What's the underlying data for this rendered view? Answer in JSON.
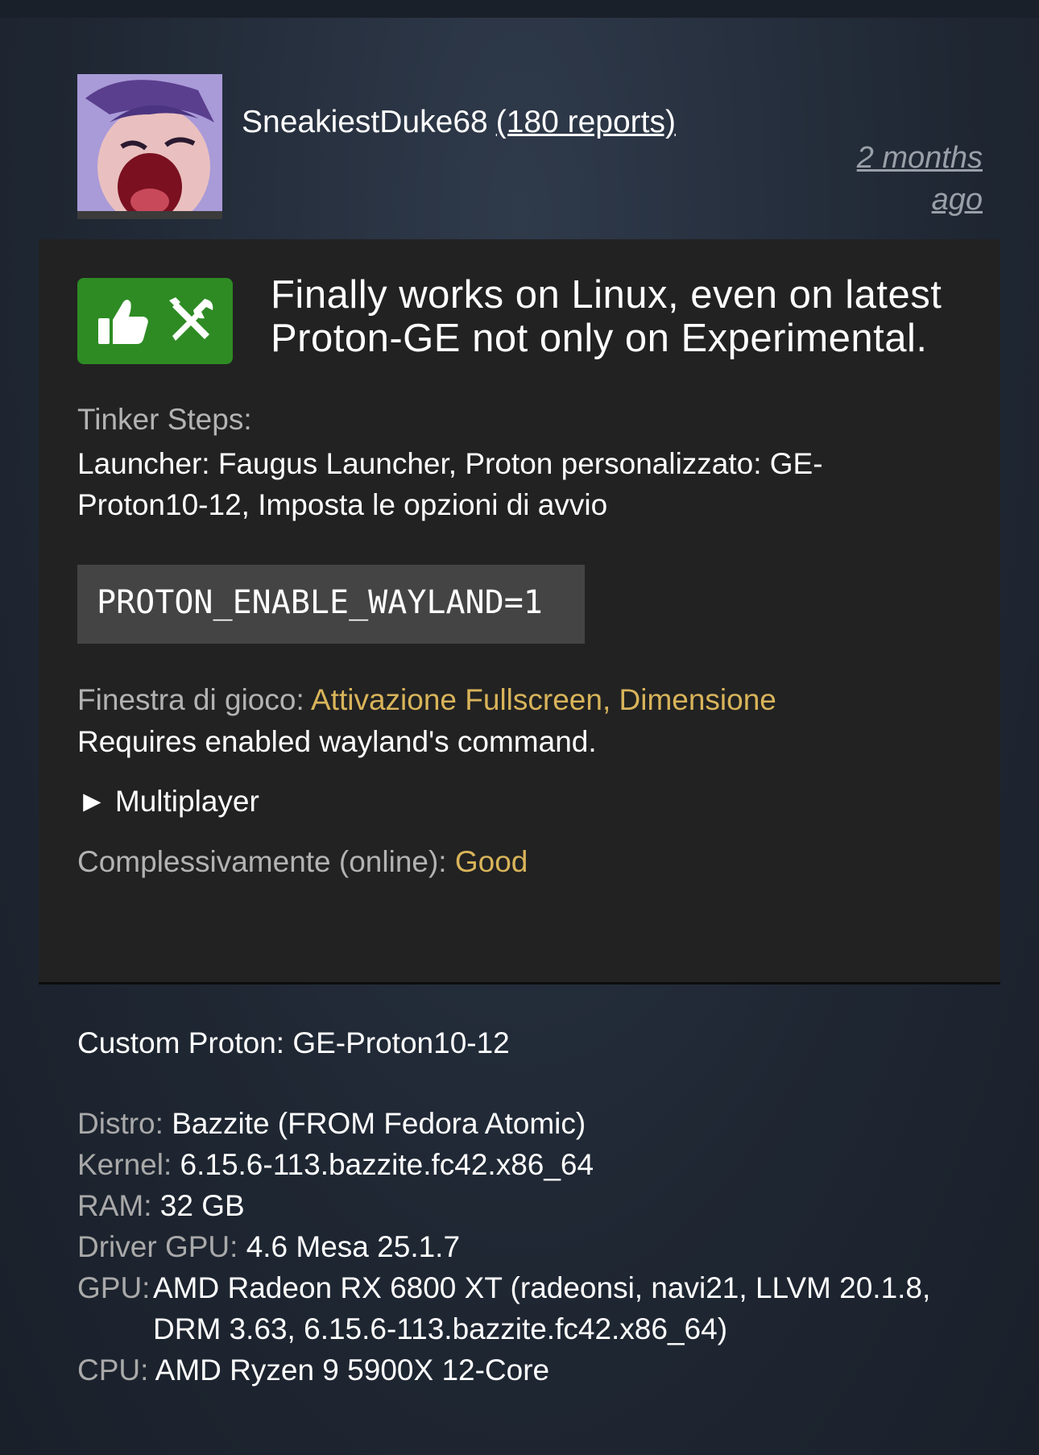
{
  "header": {
    "username": "SneakiestDuke68",
    "reports": "(180 reports)",
    "time_ago_line1": "2 months",
    "time_ago_line2": "ago"
  },
  "report": {
    "badge_icons": [
      "thumbs-up-icon",
      "tools-icon"
    ],
    "badge_color": "#2e8b24",
    "headline": "Finally works on Linux, even on latest Proton-GE not only on Experimental.",
    "tinker_label": "Tinker Steps:",
    "tinker_text": "Launcher: Faugus Launcher, Proton personalizzato: GE-Proton10-12, Imposta le opzioni di avvio",
    "code": "PROTON_ENABLE_WAYLAND=1",
    "window_label": "Finestra di gioco:",
    "window_value": "Attivazione Fullscreen, Dimensione",
    "requires_note": "Requires enabled wayland's command.",
    "multiplayer": "► Multiplayer",
    "overall_label": "Complessivamente (online):",
    "overall_value": "Good",
    "accent_color": "#d9b45a"
  },
  "system": {
    "custom_proton": "Custom Proton: GE-Proton10-12",
    "distro_label": "Distro:",
    "distro_value": "Bazzite (FROM Fedora Atomic)",
    "kernel_label": "Kernel:",
    "kernel_value": "6.15.6-113.bazzite.fc42.x86_64",
    "ram_label": "RAM:",
    "ram_value": "32 GB",
    "driver_label": "Driver GPU:",
    "driver_value": "4.6 Mesa 25.1.7",
    "gpu_label": "GPU:",
    "gpu_value_line1": "AMD Radeon RX 6800 XT (radeonsi, navi21, LLVM 20.1.8,",
    "gpu_value_line2": "DRM 3.63, 6.15.6-113.bazzite.fc42.x86_64)",
    "cpu_label": "CPU:",
    "cpu_value": "AMD Ryzen 9 5900X 12-Core"
  }
}
